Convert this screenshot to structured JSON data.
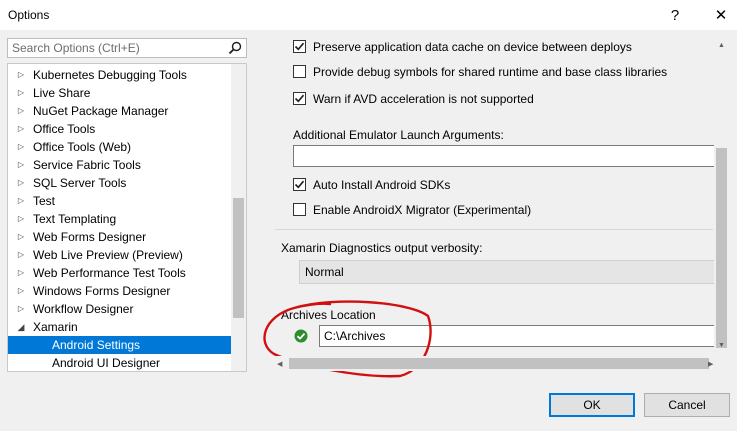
{
  "window": {
    "title": "Options",
    "help_glyph": "?",
    "close_glyph": "✕"
  },
  "search": {
    "placeholder": "Search Options (Ctrl+E)"
  },
  "tree": {
    "items": [
      {
        "label": "Kubernetes Debugging Tools",
        "expanded": false
      },
      {
        "label": "Live Share",
        "expanded": false
      },
      {
        "label": "NuGet Package Manager",
        "expanded": false
      },
      {
        "label": "Office Tools",
        "expanded": false
      },
      {
        "label": "Office Tools (Web)",
        "expanded": false
      },
      {
        "label": "Service Fabric Tools",
        "expanded": false
      },
      {
        "label": "SQL Server Tools",
        "expanded": false
      },
      {
        "label": "Test",
        "expanded": false
      },
      {
        "label": "Text Templating",
        "expanded": false
      },
      {
        "label": "Web Forms Designer",
        "expanded": false
      },
      {
        "label": "Web Live Preview (Preview)",
        "expanded": false
      },
      {
        "label": "Web Performance Test Tools",
        "expanded": false
      },
      {
        "label": "Windows Forms Designer",
        "expanded": false
      },
      {
        "label": "Workflow Designer",
        "expanded": false
      },
      {
        "label": "Xamarin",
        "expanded": true
      },
      {
        "label": "Android Settings",
        "child": true,
        "selected": true
      },
      {
        "label": "Android UI Designer",
        "child": true
      }
    ]
  },
  "settings": {
    "preserve_cache": {
      "label": "Preserve application data cache on device between deploys",
      "checked": true
    },
    "debug_symbols": {
      "label": "Provide debug symbols for shared runtime and base class libraries",
      "checked": false
    },
    "avd_warning": {
      "label": "Warn if AVD acceleration is not supported",
      "checked": true
    },
    "emulator_args": {
      "label": "Additional Emulator Launch Arguments:",
      "value": ""
    },
    "auto_install_sdks": {
      "label": "Auto Install Android SDKs",
      "checked": true
    },
    "androidx_migrator": {
      "label": "Enable AndroidX Migrator (Experimental)",
      "checked": false
    },
    "diagnostics": {
      "label": "Xamarin Diagnostics output verbosity:",
      "value": "Normal"
    },
    "archives": {
      "label": "Archives Location",
      "value": "C:\\Archives",
      "status": "valid"
    }
  },
  "buttons": {
    "ok": "OK",
    "cancel": "Cancel"
  },
  "colors": {
    "selection": "#0078d7",
    "annotation": "#d01010",
    "valid": "#2e8b2e"
  }
}
